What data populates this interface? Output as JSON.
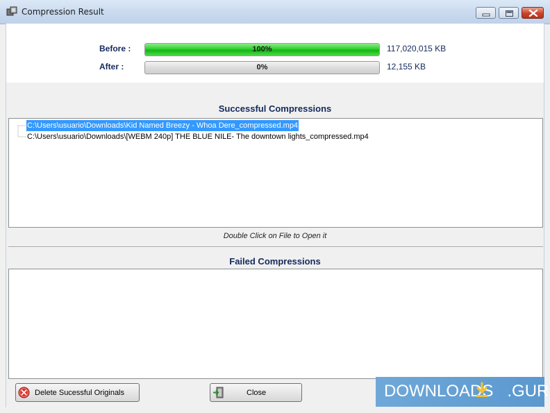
{
  "window": {
    "title": "Compression Result",
    "app_icon": "app-icon",
    "controls": [
      "minimize-icon",
      "maximize-icon",
      "close-icon"
    ]
  },
  "result": {
    "before_label": "Before :",
    "before_percent": 100,
    "before_percent_label": "100%",
    "before_size": "117,020,015 KB",
    "after_label": "After :",
    "after_percent": 0,
    "after_percent_label": "0%",
    "after_size": "12,155 KB"
  },
  "successful": {
    "title": "Successful Compressions",
    "items": [
      {
        "path": "C:\\Users\\usuario\\Downloads\\Kid Named Breezy - Whoa Dere_compressed.mp4",
        "selected": true
      },
      {
        "path": "C:\\Users\\usuario\\Downloads\\[WEBM 240p] THE BLUE NILE- The downtown lights_compressed.mp4",
        "selected": false
      }
    ],
    "hint": "Double Click on File to Open it"
  },
  "failed": {
    "title": "Failed Compressions",
    "items": []
  },
  "buttons": {
    "delete_label": "Delete Sucessful Originals",
    "delete_icon": "delete-icon",
    "close_label": "Close",
    "close_icon": "exit-door-icon"
  },
  "watermark": {
    "text": "DOWNLOADS",
    "suffix": ".GURU"
  },
  "colors": {
    "progress_green": "#13b515",
    "selection_blue": "#3399ff",
    "label_navy": "#14285a",
    "watermark_blue": "#5b98cf"
  }
}
